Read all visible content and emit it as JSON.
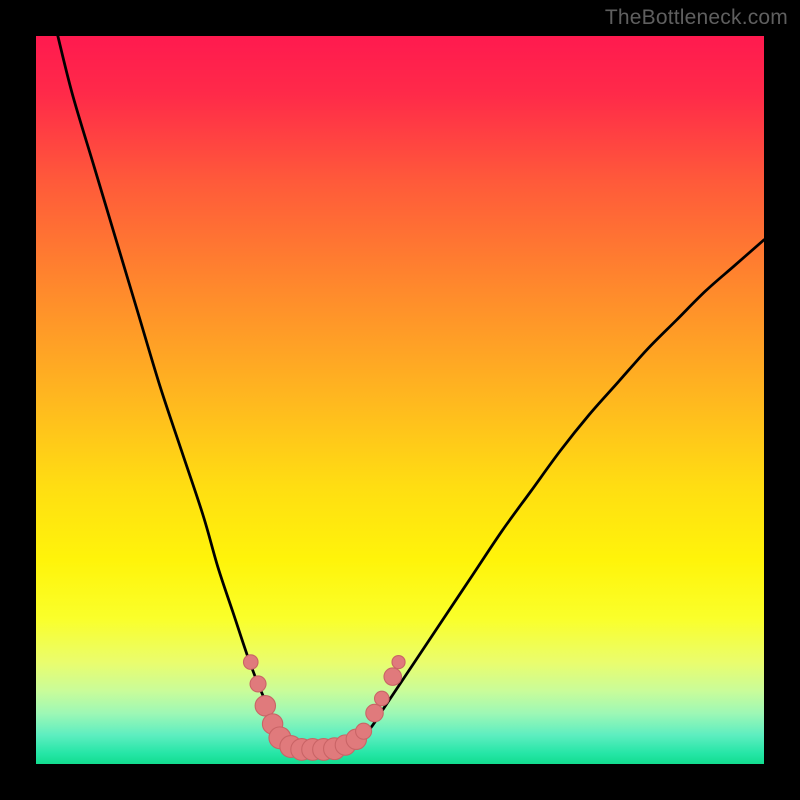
{
  "watermark": "TheBottleneck.com",
  "colors": {
    "frame": "#000000",
    "gradient_stops": [
      {
        "offset": 0.0,
        "color": "#ff1a4f"
      },
      {
        "offset": 0.08,
        "color": "#ff2a49"
      },
      {
        "offset": 0.2,
        "color": "#ff5a3a"
      },
      {
        "offset": 0.35,
        "color": "#ff8a2c"
      },
      {
        "offset": 0.5,
        "color": "#ffb81f"
      },
      {
        "offset": 0.62,
        "color": "#ffde12"
      },
      {
        "offset": 0.72,
        "color": "#fff40a"
      },
      {
        "offset": 0.8,
        "color": "#faff2a"
      },
      {
        "offset": 0.86,
        "color": "#eafd6d"
      },
      {
        "offset": 0.9,
        "color": "#c9fc9a"
      },
      {
        "offset": 0.93,
        "color": "#9ef8b5"
      },
      {
        "offset": 0.96,
        "color": "#5eeec0"
      },
      {
        "offset": 0.985,
        "color": "#26e6a7"
      },
      {
        "offset": 1.0,
        "color": "#12dd8f"
      }
    ],
    "curve": "#000000",
    "marker_fill": "#e07a7c",
    "marker_stroke": "#c96466"
  },
  "chart_data": {
    "type": "line",
    "title": "",
    "xlabel": "",
    "ylabel": "",
    "xlim": [
      0,
      100
    ],
    "ylim": [
      0,
      100
    ],
    "series": [
      {
        "name": "bottleneck-curve",
        "x": [
          3,
          5,
          8,
          11,
          14,
          17,
          20,
          23,
          25,
          27,
          29,
          30.5,
          32,
          33,
          34,
          35,
          36.5,
          38,
          40,
          42,
          44,
          46,
          48,
          52,
          56,
          60,
          64,
          68,
          72,
          76,
          80,
          84,
          88,
          92,
          96,
          100
        ],
        "y": [
          100,
          92,
          82,
          72,
          62,
          52,
          43,
          34,
          27,
          21,
          15,
          11,
          7.5,
          5,
          3.5,
          2.5,
          2,
          2,
          2,
          2.3,
          3,
          5,
          8,
          14,
          20,
          26,
          32,
          37.5,
          43,
          48,
          52.5,
          57,
          61,
          65,
          68.5,
          72
        ]
      }
    ],
    "markers": [
      {
        "x": 29.5,
        "y": 14,
        "r": 1.0
      },
      {
        "x": 30.5,
        "y": 11,
        "r": 1.1
      },
      {
        "x": 31.5,
        "y": 8,
        "r": 1.4
      },
      {
        "x": 32.5,
        "y": 5.5,
        "r": 1.4
      },
      {
        "x": 33.5,
        "y": 3.6,
        "r": 1.5
      },
      {
        "x": 35,
        "y": 2.4,
        "r": 1.5
      },
      {
        "x": 36.5,
        "y": 2.0,
        "r": 1.5
      },
      {
        "x": 38,
        "y": 2.0,
        "r": 1.5
      },
      {
        "x": 39.5,
        "y": 2.0,
        "r": 1.5
      },
      {
        "x": 41,
        "y": 2.1,
        "r": 1.5
      },
      {
        "x": 42.5,
        "y": 2.6,
        "r": 1.4
      },
      {
        "x": 44,
        "y": 3.4,
        "r": 1.4
      },
      {
        "x": 45.0,
        "y": 4.5,
        "r": 1.1
      },
      {
        "x": 46.5,
        "y": 7.0,
        "r": 1.2
      },
      {
        "x": 47.5,
        "y": 9.0,
        "r": 1.0
      },
      {
        "x": 49.0,
        "y": 12.0,
        "r": 1.2
      },
      {
        "x": 49.8,
        "y": 14.0,
        "r": 0.9
      }
    ]
  }
}
